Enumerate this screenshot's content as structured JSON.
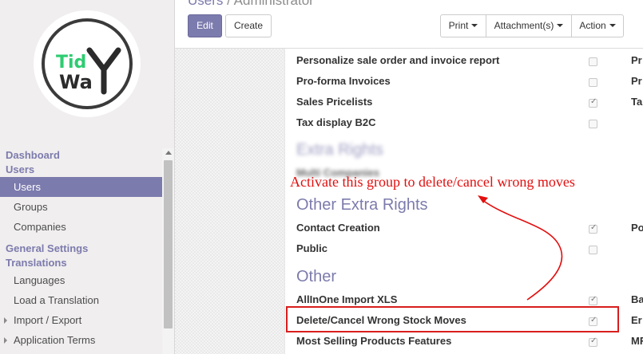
{
  "logo": {
    "line1": "Tid",
    "line2": "Wa",
    "big_letter": "Y",
    "colors": {
      "accent": "#2ecc71",
      "ring": "#3a3a3a"
    }
  },
  "sidebar": {
    "sections": [
      {
        "heading": "Dashboard"
      },
      {
        "heading": "Users",
        "items": [
          {
            "label": "Users",
            "active": true
          },
          {
            "label": "Groups"
          },
          {
            "label": "Companies"
          }
        ]
      },
      {
        "heading": "General Settings"
      },
      {
        "heading": "Translations",
        "items": [
          {
            "label": "Languages"
          },
          {
            "label": "Load a Translation"
          },
          {
            "label": "Import / Export",
            "expandable": true
          },
          {
            "label": "Application Terms",
            "expandable": true
          }
        ]
      }
    ]
  },
  "breadcrumb": {
    "parent": "Users",
    "separator": "/",
    "current": "Administrator"
  },
  "toolbar": {
    "edit": "Edit",
    "create": "Create",
    "print": "Print",
    "attachments": "Attachment(s)",
    "action": "Action"
  },
  "form": {
    "top_rows": [
      {
        "label": "Personalize sale order and invoice report",
        "checked": false,
        "right": "Pr"
      },
      {
        "label": "Pro-forma Invoices",
        "checked": false,
        "right": "Pr"
      },
      {
        "label": "Sales Pricelists",
        "checked": true,
        "right": "Ta"
      },
      {
        "label": "Tax display B2C",
        "checked": false,
        "right": ""
      }
    ],
    "extra_rights": {
      "title": "Extra Rights",
      "row": "Multi Companies"
    },
    "other_extra_rights": {
      "title": "Other Extra Rights",
      "rows": [
        {
          "label": "Contact Creation",
          "checked": true,
          "right": "Po"
        },
        {
          "label": "Public",
          "checked": false,
          "right": ""
        }
      ]
    },
    "other": {
      "title": "Other",
      "rows": [
        {
          "label": "AllInOne Import XLS",
          "checked": true,
          "right": "Ba"
        },
        {
          "label": "Delete/Cancel Wrong Stock Moves",
          "checked": true,
          "right": "Er"
        },
        {
          "label": "Most Selling Products Features",
          "checked": true,
          "right": "MF"
        }
      ]
    }
  },
  "annotation": {
    "text": "Activate this group to delete/cancel wrong moves",
    "color": "#e20f0f"
  }
}
